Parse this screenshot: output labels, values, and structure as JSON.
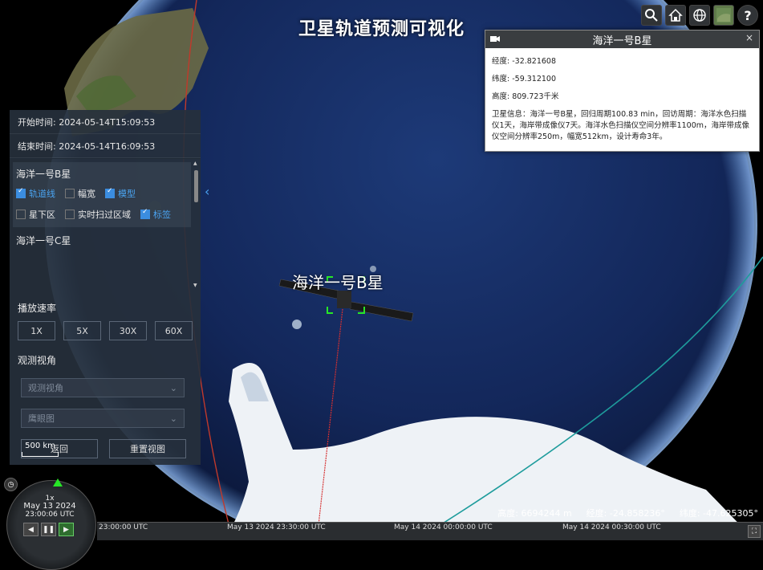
{
  "app": {
    "title": "卫星轨道预测可视化"
  },
  "toolbar": [
    {
      "icon": "search-icon"
    },
    {
      "icon": "home-icon"
    },
    {
      "icon": "globe-icon"
    },
    {
      "icon": "base-layer-icon"
    },
    {
      "icon": "help-icon",
      "glyph": "?"
    }
  ],
  "info_box": {
    "title": "海洋一号B星",
    "close": "×",
    "longitude": "经度: -32.821608",
    "latitude": "纬度: -59.312100",
    "altitude": "高度: 809.723千米",
    "description": "卫星信息：海洋一号B星，回归周期100.83 min，回访周期：海洋水色扫描仪1天，海岸带成像仪7天。海洋水色扫描仪空间分辨率1100m，海岸带成像仪空间分辨率250m，幅宽512km，设计寿命3年。"
  },
  "panel": {
    "start_time": "开始时间: 2024-05-14T15:09:53",
    "end_time": "结束时间: 2024-05-14T16:09:53",
    "satellites": [
      {
        "name": "海洋一号B星",
        "options": [
          {
            "label": "轨道线",
            "checked": true
          },
          {
            "label": "幅宽",
            "checked": false
          },
          {
            "label": "模型",
            "checked": true
          },
          {
            "label": "星下区",
            "checked": false
          },
          {
            "label": "实时扫过区域",
            "checked": false
          },
          {
            "label": "标签",
            "checked": true
          }
        ]
      },
      {
        "name": "海洋一号C星"
      }
    ],
    "speed_title": "播放速率",
    "speeds": [
      "1X",
      "5X",
      "30X",
      "60X"
    ],
    "view_title": "观测视角",
    "view_select_placeholder": "观测视角",
    "eagle_select_placeholder": "鹰眼图",
    "back_label": "返回",
    "reset_label": "重置视图"
  },
  "globe": {
    "satellite_label": "海洋一号B星",
    "scale_label": "500 km"
  },
  "status": {
    "altitude_label": "高度: 6694244 m",
    "longitude_label": "经度: -24.858236°",
    "latitude_label": "纬度: -47.625305°"
  },
  "animation": {
    "speed": "1x",
    "date": "May 13 2024",
    "time": "23:00:06 UTC"
  },
  "timeline": {
    "labels": [
      "23:00:00 UTC",
      "May 13 2024 23:30:00 UTC",
      "May 14 2024 00:00:00 UTC",
      "May 14 2024 00:30:00 UTC"
    ]
  },
  "colors": {
    "orbit_red": "#c0392b",
    "orbit_teal": "#1e9c9c",
    "accent": "#3b8de0",
    "target_green": "#27e627"
  }
}
